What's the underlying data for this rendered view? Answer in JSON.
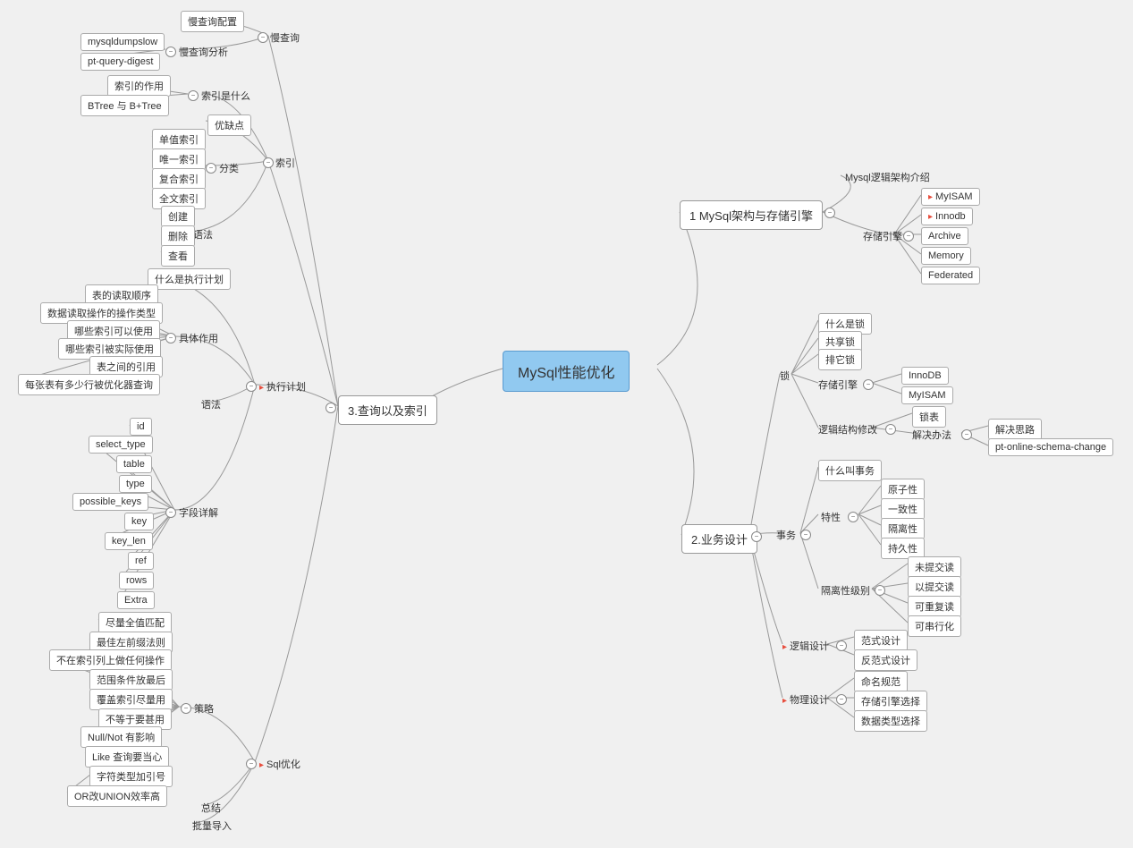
{
  "root": "MySql性能优化",
  "b1": {
    "title": "1 MySql架构与存储引擎",
    "a": "Mysql逻辑架构介绍",
    "b": "存储引擎",
    "eng": [
      "MyISAM",
      "Innodb",
      "Archive",
      "Memory",
      "Federated"
    ]
  },
  "b2": {
    "title": "2.业务设计",
    "lock": {
      "t": "锁",
      "a": "什么是锁",
      "b": "共享锁",
      "c": "排它锁",
      "d": "存储引擎",
      "e": "逻辑结构修改",
      "eng": [
        "InnoDB",
        "MyISAM"
      ],
      "mod": [
        "锁表",
        "解决办法"
      ],
      "sol": [
        "解决思路",
        "pt-online-schema-change"
      ]
    },
    "tx": {
      "t": "事务",
      "a": "什么叫事务",
      "b": "特性",
      "c": "隔离性级别",
      "props": [
        "原子性",
        "一致性",
        "隔离性",
        "持久性"
      ],
      "iso": [
        "未提交读",
        "以提交读",
        "可重复读",
        "可串行化"
      ]
    },
    "logic": {
      "t": "逻辑设计",
      "items": [
        "范式设计",
        "反范式设计"
      ]
    },
    "phys": {
      "t": "物理设计",
      "items": [
        "命名规范",
        "存储引擎选择",
        "数据类型选择"
      ]
    }
  },
  "b3": {
    "title": "3.查询以及索引",
    "slow": {
      "t": "慢查询",
      "a": "慢查询配置",
      "b": "慢查询分析",
      "tools": [
        "mysqldumpslow",
        "pt-query-digest"
      ]
    },
    "idx": {
      "t": "索引",
      "a": "索引是什么",
      "b": "优缺点",
      "c": "分类",
      "d": "语法",
      "what": [
        "索引的作用",
        "BTree 与 B+Tree"
      ],
      "types": [
        "单值索引",
        "唯一索引",
        "复合索引",
        "全文索引"
      ],
      "syn": [
        "创建",
        "删除",
        "查看"
      ]
    },
    "plan": {
      "t": "执行计划",
      "a": "什么是执行计划",
      "b": "具体作用",
      "c": "语法",
      "d": "字段详解",
      "use": [
        "表的读取顺序",
        "数据读取操作的操作类型",
        "哪些索引可以使用",
        "哪些索引被实际使用",
        "表之间的引用",
        "每张表有多少行被优化器查询"
      ],
      "fields": [
        "id",
        "select_type",
        "table",
        "type",
        "possible_keys",
        "key",
        "key_len",
        "ref",
        "rows",
        "Extra"
      ]
    },
    "opt": {
      "t": "Sql优化",
      "a": "策略",
      "b": "总结",
      "c": "批量导入",
      "strat": [
        "尽量全值匹配",
        "最佳左前缀法则",
        "不在索引列上做任何操作",
        "范围条件放最后",
        "覆盖索引尽量用",
        "不等于要甚用",
        "Null/Not 有影响",
        "Like 查询要当心",
        "字符类型加引号",
        "OR改UNION效率高"
      ]
    }
  }
}
